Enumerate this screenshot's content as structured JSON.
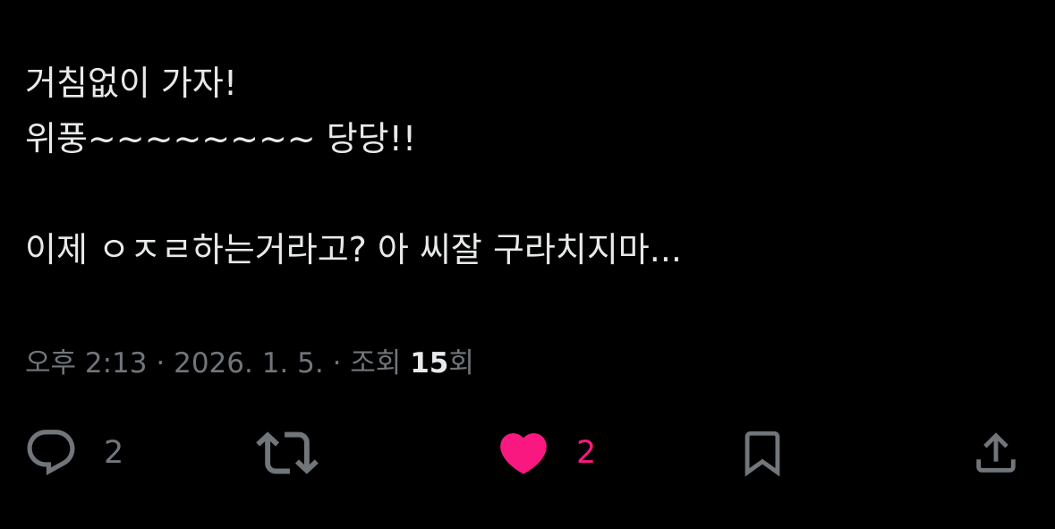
{
  "tweet": {
    "lines": [
      "거침없이 가자!",
      "위풍~~~~~~~~ 당당!!",
      "",
      "이제 ㅇㅈㄹ하는거라고? 아 씨잘 구라치지마..."
    ]
  },
  "meta": {
    "time": "오후 2:13",
    "separator": "·",
    "date": "2026. 1. 5.",
    "views_prefix": "조회",
    "views_count": "15",
    "views_suffix": "회"
  },
  "actions": {
    "reply": {
      "icon": "reply-icon",
      "count": "2"
    },
    "repost": {
      "icon": "repost-icon",
      "count": ""
    },
    "like": {
      "icon": "heart-icon",
      "count": "2",
      "liked": true
    },
    "bookmark": {
      "icon": "bookmark-icon"
    },
    "share": {
      "icon": "share-icon"
    }
  },
  "colors": {
    "background": "#000000",
    "text": "#e7e9ea",
    "secondary": "#71767b",
    "like": "#f91880"
  }
}
